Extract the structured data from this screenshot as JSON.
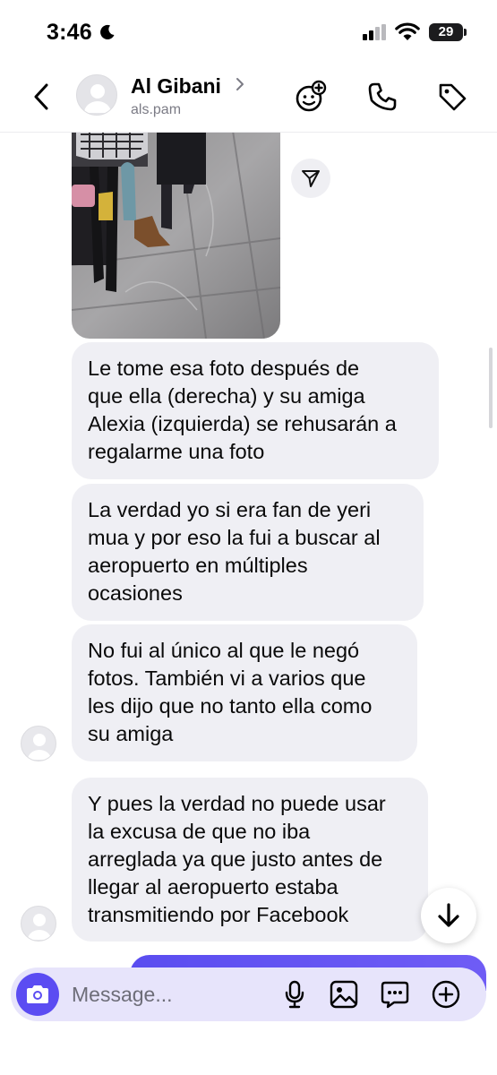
{
  "status_bar": {
    "time": "3:46",
    "battery": "29"
  },
  "header": {
    "contact_name": "Al Gibani",
    "contact_handle": "als.pam",
    "icons": [
      "back-icon",
      "chevron-right-icon",
      "avatar-sparkle-icon",
      "phone-icon",
      "tag-icon"
    ]
  },
  "chat": {
    "photo_alt": "",
    "messages": [
      {
        "text": "Le tome esa foto después de\nque ella (derecha) y su amiga\nAlexia (izquierda) se rehusarán a\nregalarme una foto"
      },
      {
        "text": "La verdad yo si era fan de yeri\nmua y por eso la fui a buscar al\naeropuerto en múltiples\nocasiones"
      },
      {
        "text": "No fui al único al que le negó\nfotos. También vi a varios que\nles dijo que no tanto ella como\nsu amiga"
      },
      {
        "text": "Y pues la verdad no puede usar\nla excusa de que no iba\narreglada ya que justo antes de\nllegar al aeropuerto estaba\ntransmitiendo por Facebook"
      }
    ]
  },
  "composer": {
    "placeholder": "Message...",
    "icons": [
      "camera-icon",
      "microphone-icon",
      "gallery-icon",
      "sticker-icon",
      "add-icon"
    ]
  },
  "colors": {
    "accent": "#5b4cf2",
    "bubble_incoming": "#efeff4",
    "composer_bg": "#e7e4fb"
  }
}
